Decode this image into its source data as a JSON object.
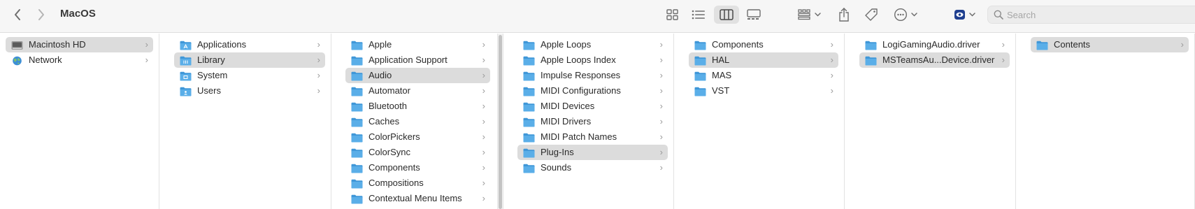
{
  "window": {
    "title": "MacOS"
  },
  "toolbar": {
    "search_placeholder": "Search",
    "icons": [
      "chevron-left-icon",
      "chevron-right-icon",
      "icon-view-icon",
      "list-view-icon",
      "column-view-icon",
      "gallery-view-icon",
      "group-icon",
      "share-icon",
      "tag-icon",
      "more-actions-icon",
      "eye-icon",
      "search-icon"
    ]
  },
  "colors": {
    "folder": "#5aaee8",
    "folder_dark": "#3f97d8",
    "selection": "#dcdcdc"
  },
  "columns": [
    {
      "items": [
        {
          "label": "Macintosh HD",
          "icon": "hard-drive-icon",
          "selected": true
        },
        {
          "label": "Network",
          "icon": "network-globe-icon",
          "selected": false
        }
      ]
    },
    {
      "items": [
        {
          "label": "Applications",
          "icon": "applications-folder-icon",
          "selected": false
        },
        {
          "label": "Library",
          "icon": "library-folder-icon",
          "selected": true
        },
        {
          "label": "System",
          "icon": "system-folder-icon",
          "selected": false
        },
        {
          "label": "Users",
          "icon": "users-folder-icon",
          "selected": false
        }
      ]
    },
    {
      "items": [
        {
          "label": "Apple",
          "selected": false
        },
        {
          "label": "Application Support",
          "selected": false
        },
        {
          "label": "Audio",
          "selected": true
        },
        {
          "label": "Automator",
          "selected": false
        },
        {
          "label": "Bluetooth",
          "selected": false
        },
        {
          "label": "Caches",
          "selected": false
        },
        {
          "label": "ColorPickers",
          "selected": false
        },
        {
          "label": "ColorSync",
          "selected": false
        },
        {
          "label": "Components",
          "selected": false
        },
        {
          "label": "Compositions",
          "selected": false
        },
        {
          "label": "Contextual Menu Items",
          "selected": false
        }
      ]
    },
    {
      "items": [
        {
          "label": "Apple Loops",
          "selected": false
        },
        {
          "label": "Apple Loops Index",
          "selected": false
        },
        {
          "label": "Impulse Responses",
          "selected": false
        },
        {
          "label": "MIDI Configurations",
          "selected": false
        },
        {
          "label": "MIDI Devices",
          "selected": false
        },
        {
          "label": "MIDI Drivers",
          "selected": false
        },
        {
          "label": "MIDI Patch Names",
          "selected": false
        },
        {
          "label": "Plug-Ins",
          "selected": true
        },
        {
          "label": "Sounds",
          "selected": false
        }
      ]
    },
    {
      "items": [
        {
          "label": "Components",
          "selected": false
        },
        {
          "label": "HAL",
          "selected": true
        },
        {
          "label": "MAS",
          "selected": false
        },
        {
          "label": "VST",
          "selected": false
        }
      ]
    },
    {
      "items": [
        {
          "label": "LogiGamingAudio.driver",
          "selected": false
        },
        {
          "label": "MSTeamsAu...Device.driver",
          "selected": true
        }
      ]
    },
    {
      "items": [
        {
          "label": "Contents",
          "selected": true
        }
      ]
    }
  ]
}
